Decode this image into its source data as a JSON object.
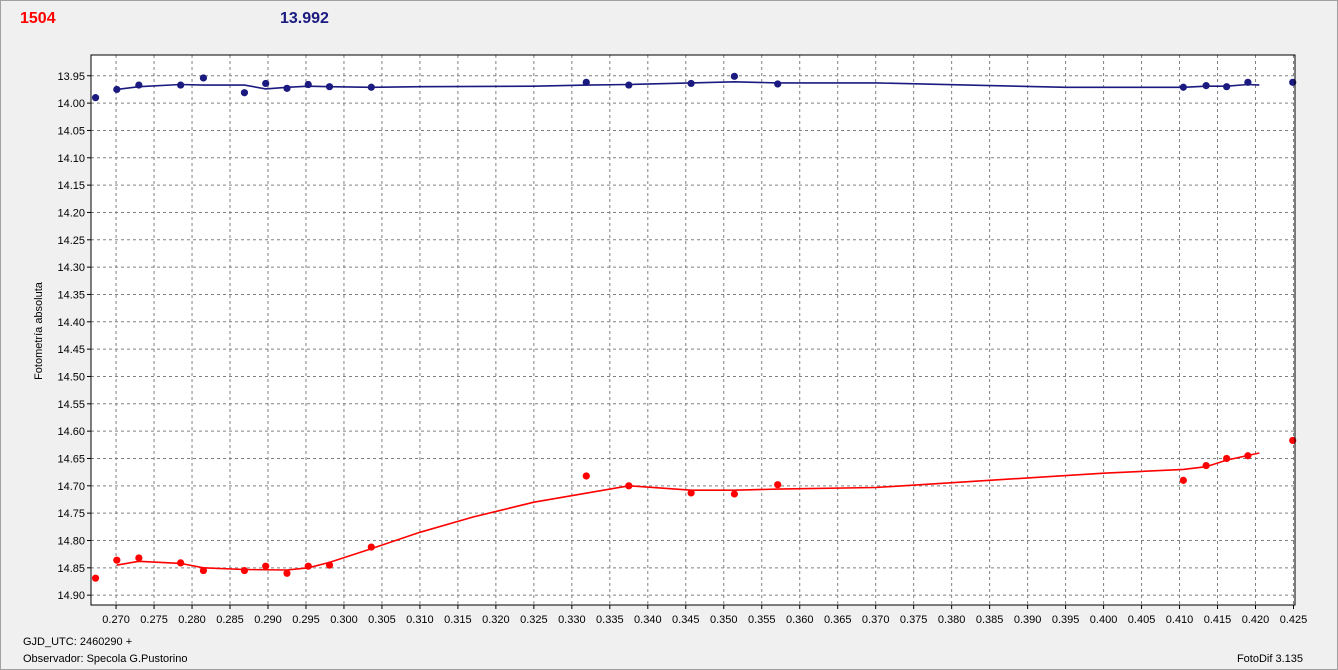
{
  "header": {
    "left_value": "1504",
    "left_color": "#ff0000",
    "right_value": "13.992",
    "right_color": "#1a1a80"
  },
  "footer": {
    "gjd": "GJD_UTC: 2460290 +",
    "observer": "Observador: Specola G.Pustorino",
    "software": "FotoDif 3.135"
  },
  "chart_data": {
    "type": "scatter",
    "ylabel": "Fotometría absoluta",
    "xlim": [
      0.2667,
      0.4252
    ],
    "ylim": [
      14.918,
      13.912
    ],
    "y_inverted": true,
    "grid": true,
    "x_ticks": [
      0.27,
      0.275,
      0.28,
      0.285,
      0.29,
      0.295,
      0.3,
      0.305,
      0.31,
      0.315,
      0.32,
      0.325,
      0.33,
      0.335,
      0.34,
      0.345,
      0.35,
      0.355,
      0.36,
      0.365,
      0.37,
      0.375,
      0.38,
      0.385,
      0.39,
      0.395,
      0.4,
      0.405,
      0.41,
      0.415,
      0.42,
      0.425
    ],
    "x_tick_labels": [
      "0.270",
      "0.275",
      "0.280",
      "0.285",
      "0.290",
      "0.295",
      "0.300",
      "0.305",
      "0.310",
      "0.315",
      "0.320",
      "0.325",
      "0.330",
      "0.335",
      "0.340",
      "0.345",
      "0.350",
      "0.355",
      "0.360",
      "0.365",
      "0.370",
      "0.375",
      "0.380",
      "0.385",
      "0.390",
      "0.395",
      "0.400",
      "0.405",
      "0.410",
      "0.415",
      "0.420",
      "0.425"
    ],
    "y_ticks": [
      13.95,
      14.0,
      14.05,
      14.1,
      14.15,
      14.2,
      14.25,
      14.3,
      14.35,
      14.4,
      14.45,
      14.5,
      14.55,
      14.6,
      14.65,
      14.7,
      14.75,
      14.8,
      14.85,
      14.9
    ],
    "y_tick_labels": [
      "13.95",
      "14.00",
      "14.05",
      "14.10",
      "14.15",
      "14.20",
      "14.25",
      "14.30",
      "14.35",
      "14.40",
      "14.45",
      "14.50",
      "14.55",
      "14.60",
      "14.65",
      "14.70",
      "14.75",
      "14.80",
      "14.85",
      "14.90"
    ],
    "series": [
      {
        "color": "#1a1a80",
        "points": [
          [
            0.2673,
            13.99
          ],
          [
            0.2701,
            13.975
          ],
          [
            0.273,
            13.967
          ],
          [
            0.2785,
            13.967
          ],
          [
            0.2815,
            13.954
          ],
          [
            0.2869,
            13.981
          ],
          [
            0.2897,
            13.964
          ],
          [
            0.2925,
            13.973
          ],
          [
            0.2953,
            13.966
          ],
          [
            0.2981,
            13.97
          ],
          [
            0.3036,
            13.971
          ],
          [
            0.3319,
            13.962
          ],
          [
            0.3375,
            13.967
          ],
          [
            0.3457,
            13.964
          ],
          [
            0.3514,
            13.951
          ],
          [
            0.3571,
            13.965
          ],
          [
            0.4105,
            13.971
          ],
          [
            0.4135,
            13.968
          ],
          [
            0.4162,
            13.97
          ],
          [
            0.419,
            13.962
          ],
          [
            0.4249,
            13.962
          ]
        ],
        "trend": [
          [
            0.2701,
            13.975
          ],
          [
            0.273,
            13.97
          ],
          [
            0.2785,
            13.966
          ],
          [
            0.2815,
            13.967
          ],
          [
            0.2869,
            13.967
          ],
          [
            0.2897,
            13.974
          ],
          [
            0.2925,
            13.971
          ],
          [
            0.2953,
            13.969
          ],
          [
            0.2981,
            13.97
          ],
          [
            0.3036,
            13.971
          ],
          [
            0.31,
            13.97
          ],
          [
            0.325,
            13.969
          ],
          [
            0.3319,
            13.967
          ],
          [
            0.3375,
            13.966
          ],
          [
            0.3457,
            13.963
          ],
          [
            0.3514,
            13.961
          ],
          [
            0.3571,
            13.963
          ],
          [
            0.37,
            13.963
          ],
          [
            0.385,
            13.968
          ],
          [
            0.395,
            13.971
          ],
          [
            0.4105,
            13.971
          ],
          [
            0.4135,
            13.969
          ],
          [
            0.4162,
            13.969
          ],
          [
            0.419,
            13.966
          ],
          [
            0.4205,
            13.967
          ]
        ]
      },
      {
        "color": "#ff0000",
        "points": [
          [
            0.2673,
            14.869
          ],
          [
            0.2701,
            14.836
          ],
          [
            0.273,
            14.832
          ],
          [
            0.2785,
            14.841
          ],
          [
            0.2815,
            14.855
          ],
          [
            0.2869,
            14.855
          ],
          [
            0.2897,
            14.847
          ],
          [
            0.2925,
            14.86
          ],
          [
            0.2953,
            14.847
          ],
          [
            0.2981,
            14.845
          ],
          [
            0.3036,
            14.812
          ],
          [
            0.3319,
            14.682
          ],
          [
            0.3375,
            14.7
          ],
          [
            0.3457,
            14.713
          ],
          [
            0.3514,
            14.715
          ],
          [
            0.3571,
            14.698
          ],
          [
            0.4105,
            14.69
          ],
          [
            0.4135,
            14.663
          ],
          [
            0.4162,
            14.65
          ],
          [
            0.419,
            14.645
          ],
          [
            0.4249,
            14.617
          ]
        ],
        "trend": [
          [
            0.2701,
            14.845
          ],
          [
            0.273,
            14.838
          ],
          [
            0.2785,
            14.842
          ],
          [
            0.2815,
            14.85
          ],
          [
            0.2869,
            14.853
          ],
          [
            0.2925,
            14.854
          ],
          [
            0.2953,
            14.85
          ],
          [
            0.2981,
            14.84
          ],
          [
            0.3036,
            14.815
          ],
          [
            0.31,
            14.785
          ],
          [
            0.317,
            14.757
          ],
          [
            0.325,
            14.73
          ],
          [
            0.3375,
            14.7
          ],
          [
            0.3457,
            14.708
          ],
          [
            0.3514,
            14.708
          ],
          [
            0.3571,
            14.706
          ],
          [
            0.37,
            14.703
          ],
          [
            0.385,
            14.69
          ],
          [
            0.4,
            14.677
          ],
          [
            0.4105,
            14.67
          ],
          [
            0.4135,
            14.665
          ],
          [
            0.4162,
            14.653
          ],
          [
            0.4205,
            14.64
          ]
        ]
      }
    ]
  }
}
